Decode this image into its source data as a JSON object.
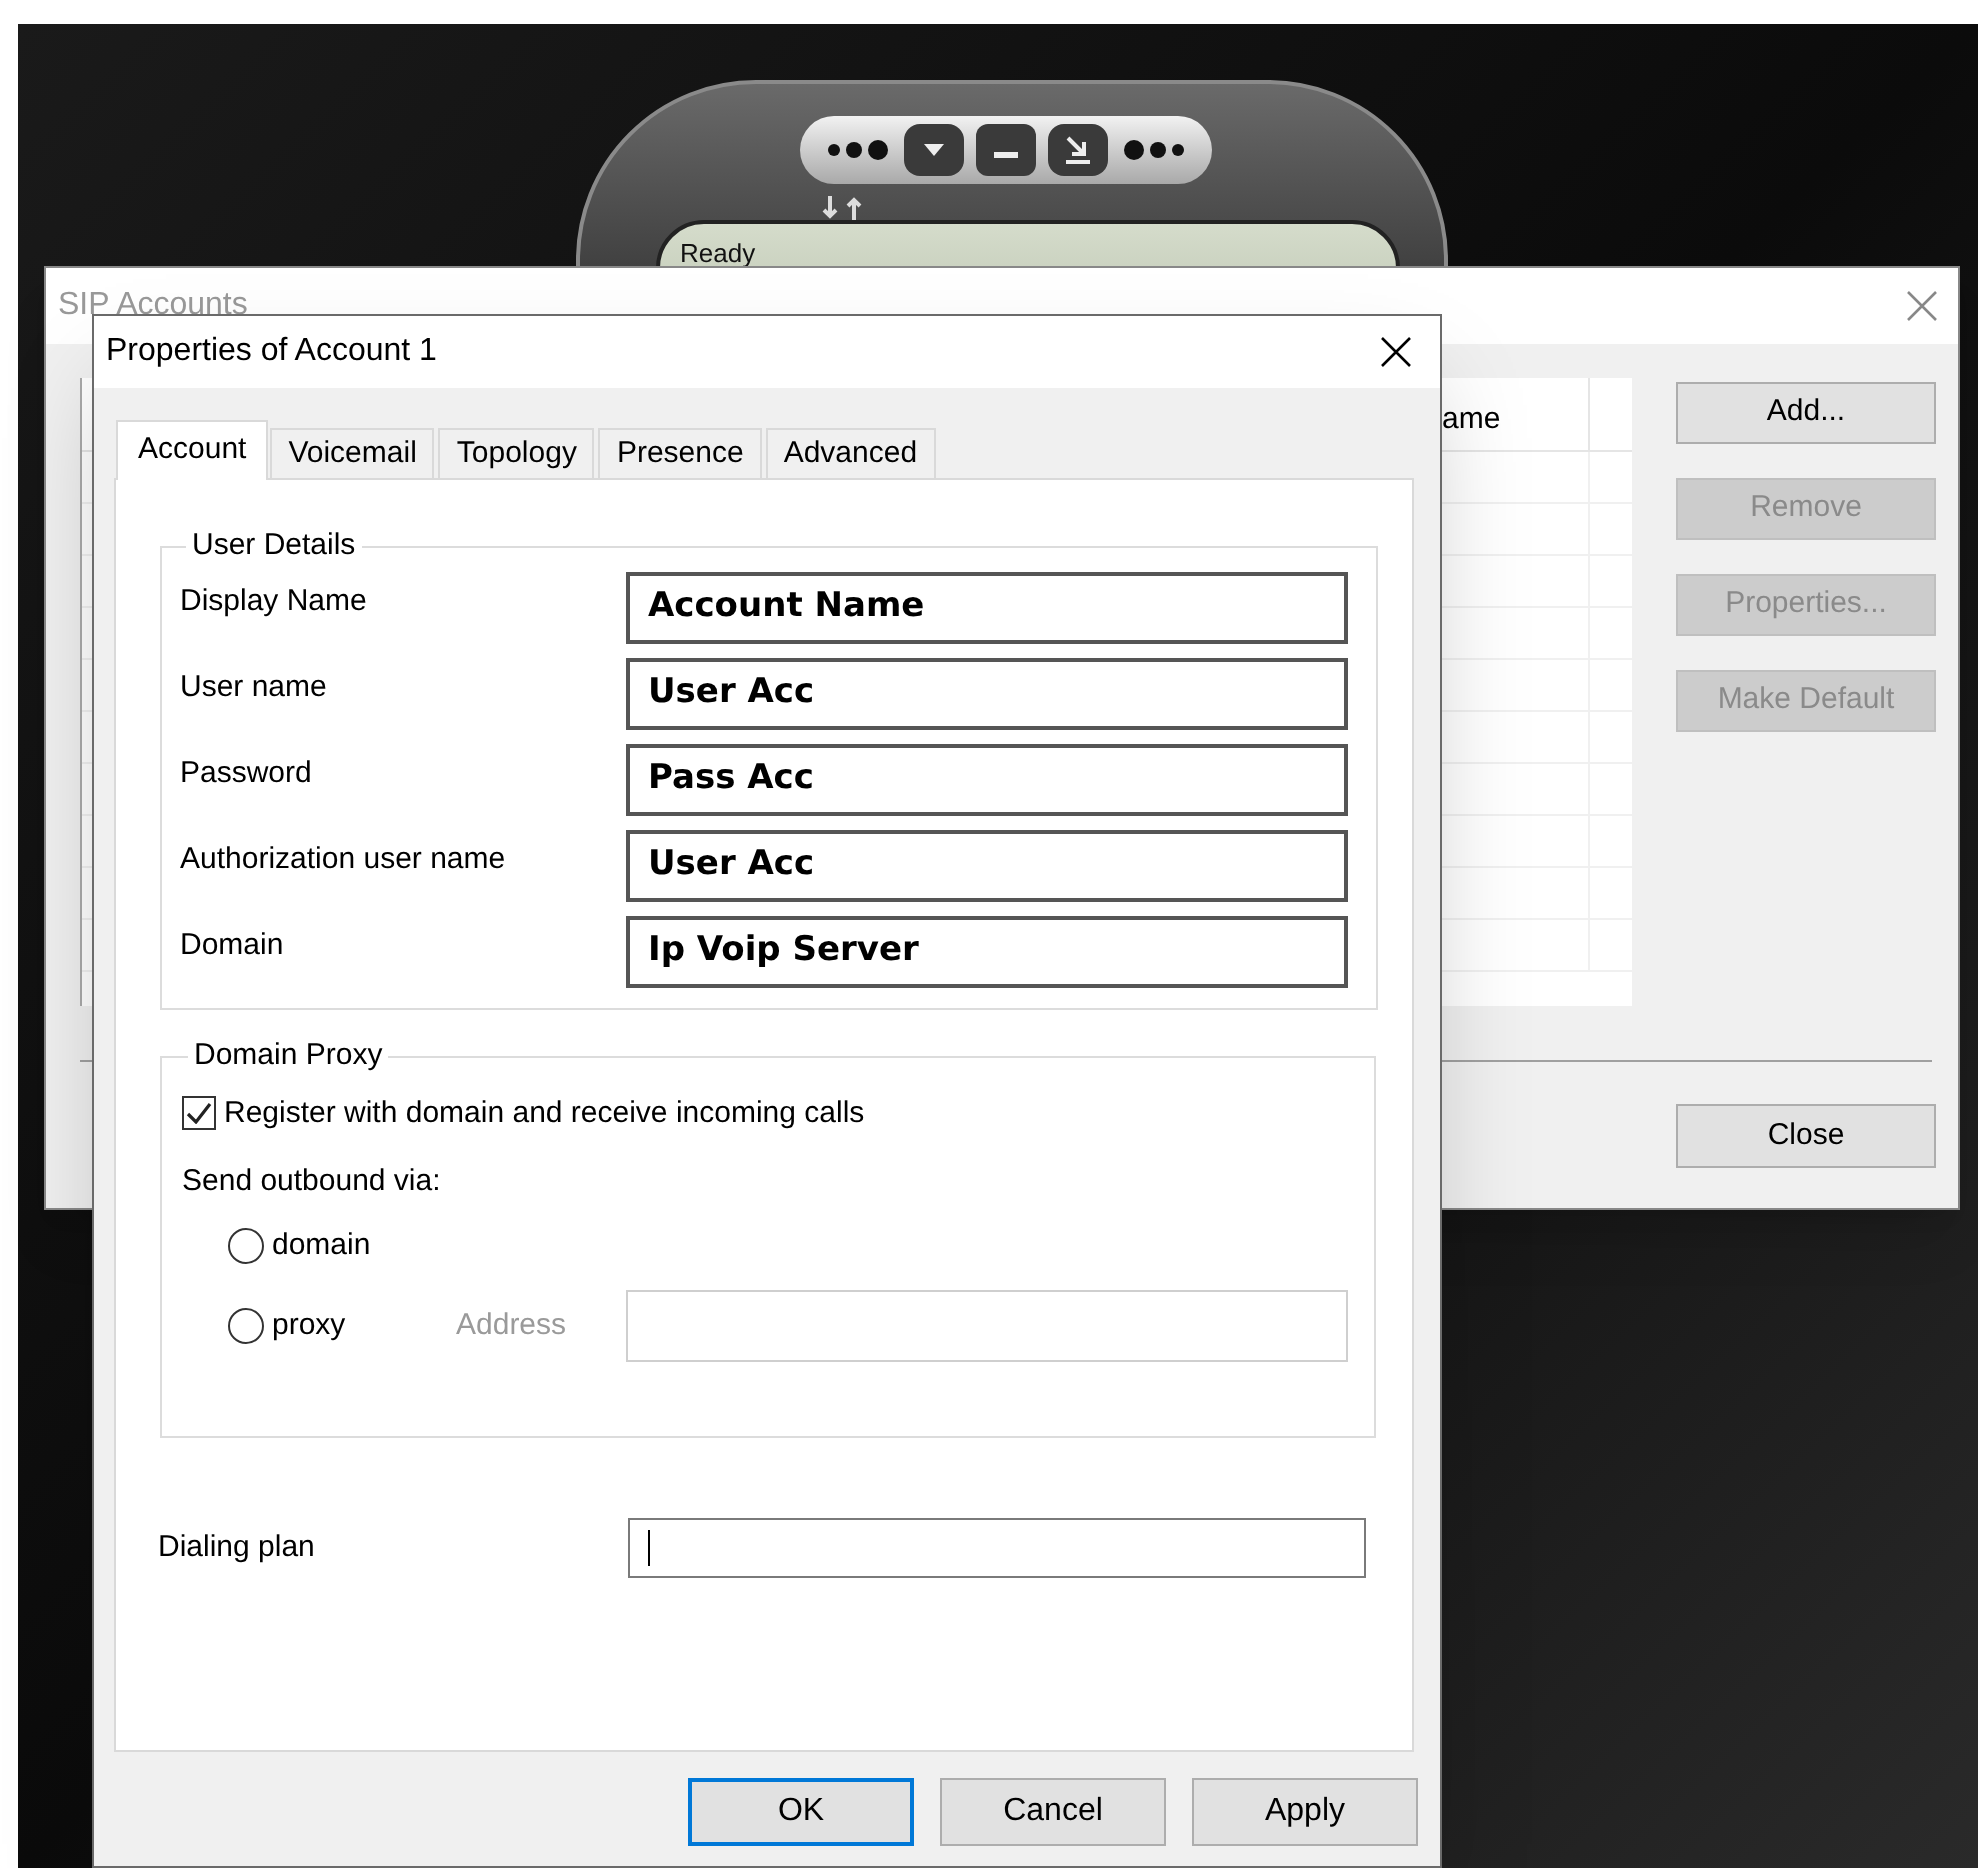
{
  "softphone": {
    "status": "Ready"
  },
  "sip_accounts": {
    "title": "SIP Accounts",
    "columns": [
      "ame"
    ],
    "buttons": [
      {
        "label": "Add...",
        "disabled": false
      },
      {
        "label": "Remove",
        "disabled": true
      },
      {
        "label": "Properties...",
        "disabled": true
      },
      {
        "label": "Make Default",
        "disabled": true
      }
    ],
    "close_button": "Close"
  },
  "properties": {
    "title": "Properties of Account 1",
    "tabs": [
      {
        "label": "Account",
        "selected": true
      },
      {
        "label": "Voicemail",
        "selected": false
      },
      {
        "label": "Topology",
        "selected": false
      },
      {
        "label": "Presence",
        "selected": false
      },
      {
        "label": "Advanced",
        "selected": false
      }
    ],
    "user_details": {
      "title": "User Details",
      "fields": [
        {
          "label": "Display Name",
          "value": "Account Name"
        },
        {
          "label": "User name",
          "value": "User Acc"
        },
        {
          "label": "Password",
          "value": "Pass Acc"
        },
        {
          "label": "Authorization user name",
          "value": "User Acc"
        },
        {
          "label": "Domain",
          "value": "Ip Voip Server"
        }
      ]
    },
    "domain_proxy": {
      "title": "Domain Proxy",
      "register": {
        "label": "Register with domain and receive incoming calls",
        "checked": true
      },
      "send_via_label": "Send outbound via:",
      "options": [
        {
          "label": "domain",
          "selected": false
        },
        {
          "label": "proxy",
          "selected": false
        }
      ],
      "address": {
        "label": "Address",
        "disabled": true
      }
    },
    "dialing_plan": {
      "label": "Dialing plan",
      "focused": true
    },
    "buttons": [
      {
        "label": "OK",
        "default": true
      },
      {
        "label": "Cancel",
        "default": false
      },
      {
        "label": "Apply",
        "default": false
      }
    ]
  }
}
